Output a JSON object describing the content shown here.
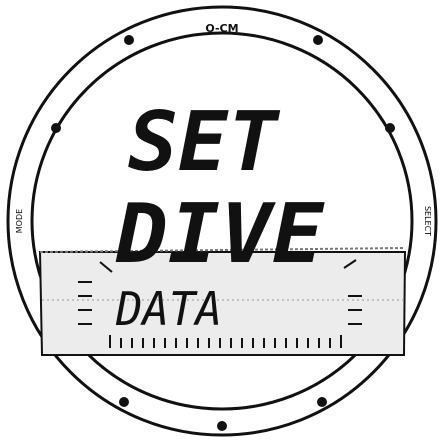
{
  "bezel": {
    "top_label": "O-CM",
    "left_label": "MODE",
    "right_label": "SELECT"
  },
  "display": {
    "line1": "SET",
    "line2": "DIVE",
    "line3": "DATA"
  },
  "colors": {
    "ink": "#111111",
    "background": "#ffffff",
    "lcd_shade": "#e9e9e9"
  }
}
